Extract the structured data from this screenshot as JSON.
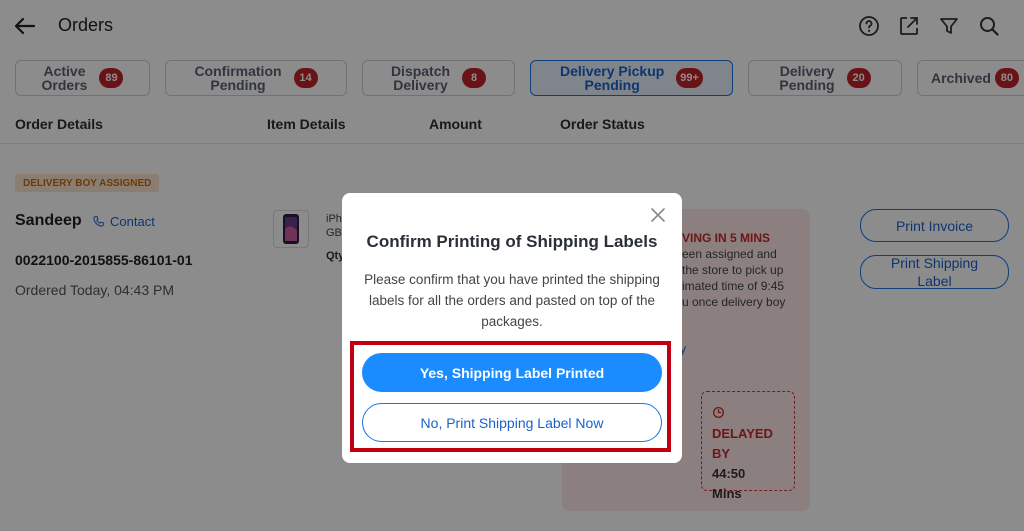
{
  "header": {
    "title": "Orders",
    "back_icon": "back-arrow-icon",
    "icons": [
      "help-icon",
      "export-icon",
      "filter-icon",
      "search-icon"
    ]
  },
  "tabs": [
    {
      "label": "Active\nOrders",
      "count": "89",
      "active": false
    },
    {
      "label": "Confirmation\nPending",
      "count": "14",
      "active": false
    },
    {
      "label": "Dispatch\nDelivery",
      "count": "8",
      "active": false
    },
    {
      "label": "Delivery Pickup\nPending",
      "count": "99+",
      "active": true
    },
    {
      "label": "Delivery\nPending",
      "count": "20",
      "active": false
    },
    {
      "label": "Archived",
      "count": "80",
      "active": false
    }
  ],
  "columns": [
    "Order Details",
    "Item Details",
    "Amount",
    "Order Status"
  ],
  "order": {
    "status_tag": "DELIVERY BOY ASSIGNED",
    "customer": "Sandeep",
    "contact_label": "Contact",
    "order_id": "0022100-2015855-86101-01",
    "ordered_at": "Ordered Today, 04:43 PM",
    "item_name_line1": "iPh",
    "item_name_line2": "GB",
    "item_qty": "Qty",
    "arriving_label": "VING IN 5 MINS",
    "arriving_text": "een assigned and\nthe store to pick up\nimated time of 9:45\nu once delivery boy",
    "view_link": "y",
    "delayed_label": "DELAYED",
    "delayed_by": "BY",
    "delayed_time": "44:50",
    "delayed_unit": "Mins",
    "print_invoice": "Print Invoice",
    "print_label": "Print Shipping\nLabel"
  },
  "modal": {
    "title": "Confirm Printing of Shipping Labels",
    "body": "Please confirm that you have printed the shipping labels for all the orders and pasted on top of the packages.",
    "confirm_label": "Yes, Shipping Label Printed",
    "print_now_label": "No, Print Shipping Label Now"
  },
  "colors": {
    "accent": "#1a8cff",
    "badge": "#c0232b",
    "highlight": "#c00012"
  }
}
